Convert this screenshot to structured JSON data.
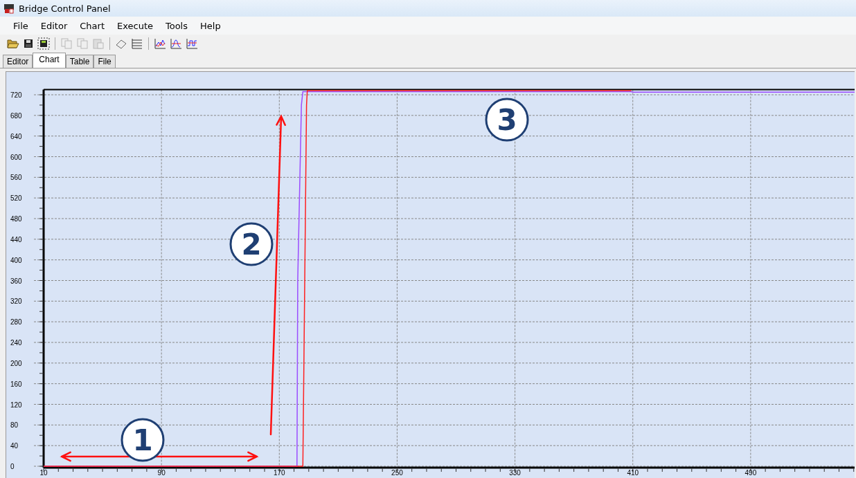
{
  "window": {
    "title": "Bridge Control Panel"
  },
  "menu": [
    {
      "label": "File"
    },
    {
      "label": "Editor"
    },
    {
      "label": "Chart"
    },
    {
      "label": "Execute"
    },
    {
      "label": "Tools"
    },
    {
      "label": "Help"
    }
  ],
  "toolbar": [
    {
      "kind": "open",
      "disabled": false
    },
    {
      "kind": "save",
      "disabled": false
    },
    {
      "kind": "save-all",
      "disabled": false
    },
    {
      "kind": "sep"
    },
    {
      "kind": "copy",
      "disabled": true
    },
    {
      "kind": "copy",
      "disabled": true
    },
    {
      "kind": "paste",
      "disabled": true
    },
    {
      "kind": "sep"
    },
    {
      "kind": "eraser",
      "disabled": false
    },
    {
      "kind": "list",
      "disabled": false
    },
    {
      "kind": "sep"
    },
    {
      "kind": "chart-line",
      "disabled": false
    },
    {
      "kind": "chart-bell",
      "disabled": false
    },
    {
      "kind": "chart-square",
      "disabled": false
    }
  ],
  "tabs": [
    {
      "label": "Editor",
      "selected": false
    },
    {
      "label": "Chart",
      "selected": true
    },
    {
      "label": "Table",
      "selected": false
    },
    {
      "label": "File",
      "selected": false
    }
  ],
  "chart": {
    "chart_data": {
      "type": "line",
      "grid": true,
      "xlim": [
        10,
        562
      ],
      "ylim": [
        0,
        730
      ],
      "xticks": [
        10,
        90,
        170,
        250,
        330,
        410,
        490
      ],
      "yticks": [
        0,
        40,
        80,
        120,
        160,
        200,
        240,
        280,
        320,
        360,
        400,
        440,
        480,
        520,
        560,
        600,
        640,
        680,
        720
      ],
      "x": [
        10,
        182,
        182.5,
        185,
        186,
        188.5,
        189,
        409,
        410,
        562
      ],
      "series": [
        {
          "color": "#9b4dff",
          "values": [
            0,
            0,
            360,
            700,
            726,
            726,
            726,
            726,
            725,
            725
          ]
        },
        {
          "color": "#ff2020",
          "values": [
            0,
            0,
            0,
            0,
            0,
            700,
            728,
            728,
            null,
            null
          ]
        }
      ]
    },
    "callouts": [
      {
        "label": "1"
      },
      {
        "label": "2"
      },
      {
        "label": "3"
      }
    ]
  }
}
